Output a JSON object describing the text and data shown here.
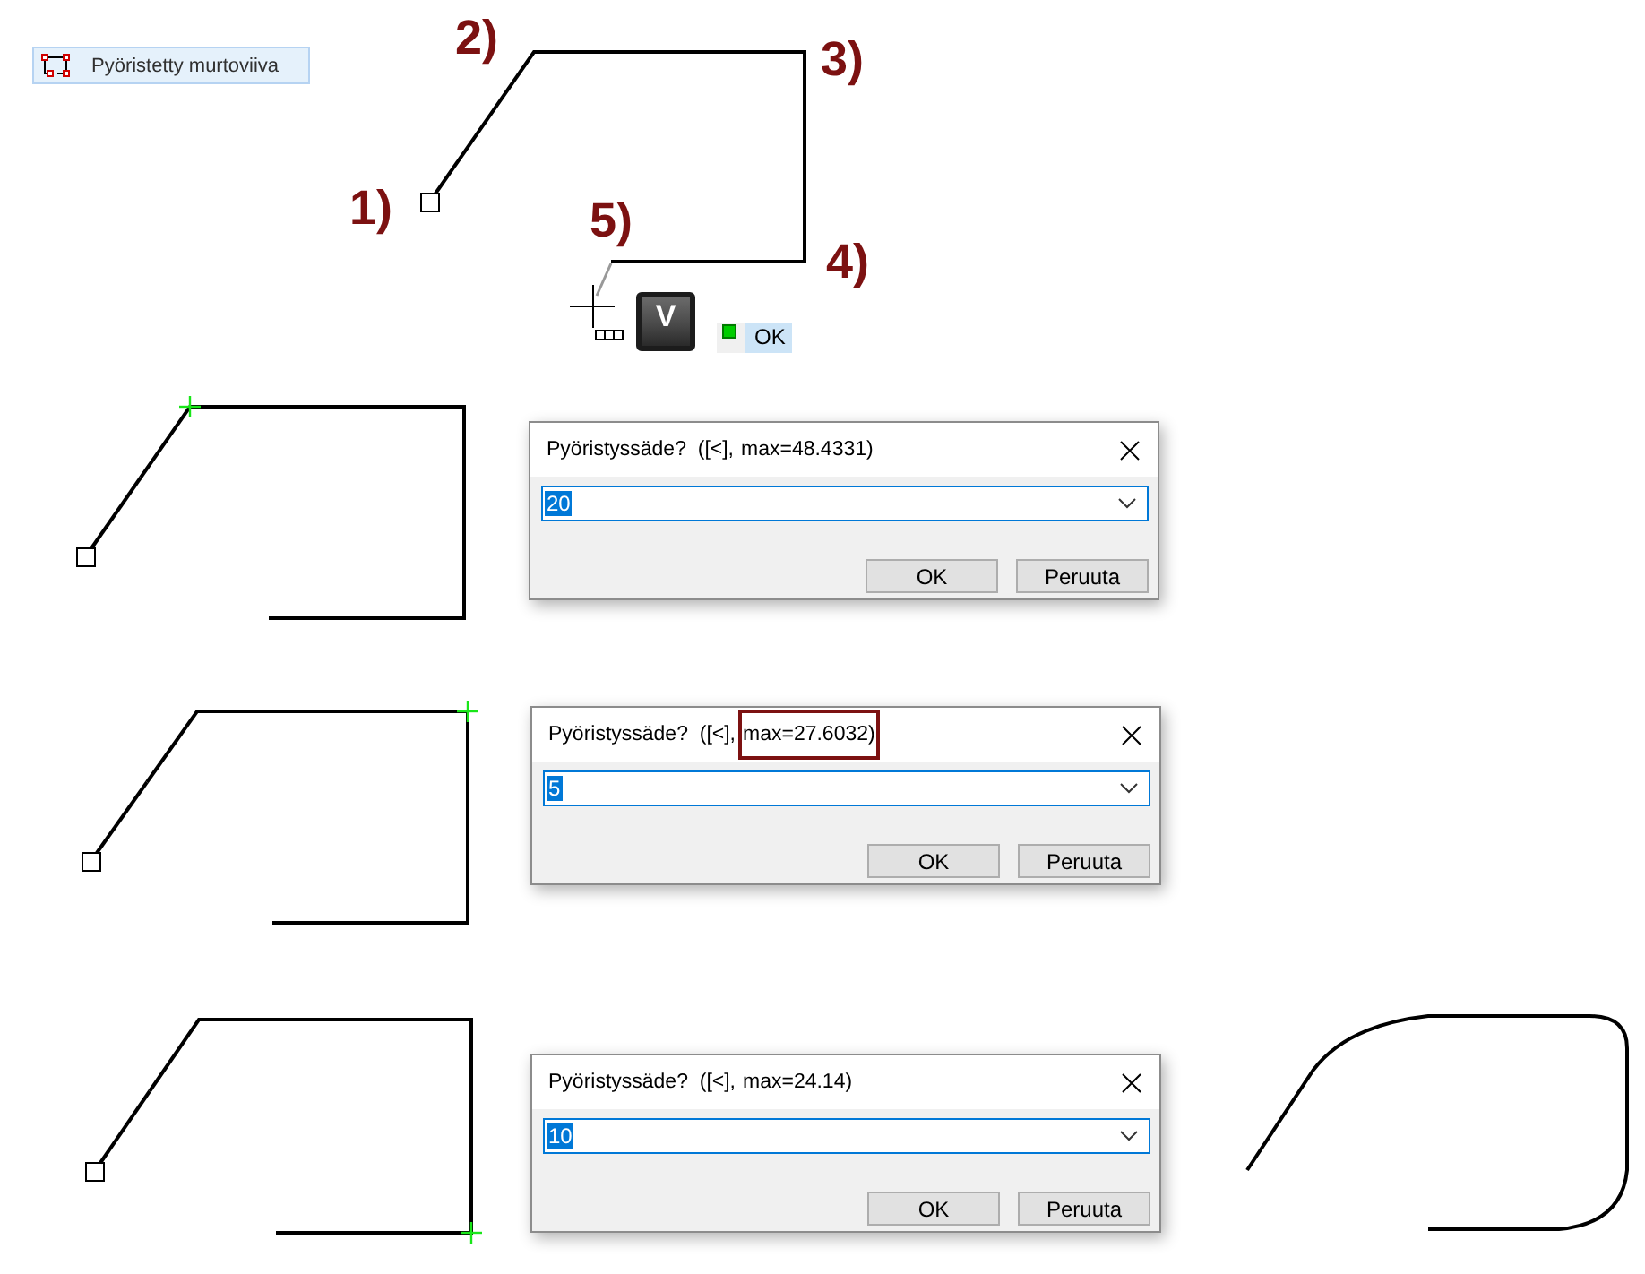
{
  "toolbar_button": {
    "label": "Pyöristetty murtoviiva"
  },
  "step_labels": [
    "1)",
    "2)",
    "3)",
    "4)",
    "5)"
  ],
  "key_hint": {
    "key": "V"
  },
  "status": {
    "label": "OK",
    "on": true
  },
  "scenes": [
    {
      "corners": [
        {
          "selected": true
        },
        {
          "selected": false
        },
        {
          "selected": false
        }
      ],
      "dialog": {
        "prompt": "Pyöristyssäde?  ([<],",
        "max": "max=48.4331)",
        "highlighted": false,
        "value": "20",
        "value_selected": true,
        "buttons": [
          "OK",
          "Peruuta"
        ]
      }
    },
    {
      "corners": [
        {
          "selected": false
        },
        {
          "selected": true
        },
        {
          "selected": false
        }
      ],
      "dialog": {
        "prompt": "Pyöristyssäde?  ([<],",
        "max": "max=27.6032)",
        "highlighted": true,
        "value": "5",
        "value_selected": true,
        "buttons": [
          "OK",
          "Peruuta"
        ]
      }
    },
    {
      "corners": [
        {
          "selected": false
        },
        {
          "selected": false
        },
        {
          "selected": true
        }
      ],
      "dialog": {
        "prompt": "Pyöristyssäde?  ([<],",
        "max": "max=24.14)",
        "highlighted": false,
        "value": "10",
        "value_selected": true,
        "buttons": [
          "OK",
          "Peruuta"
        ]
      }
    }
  ]
}
